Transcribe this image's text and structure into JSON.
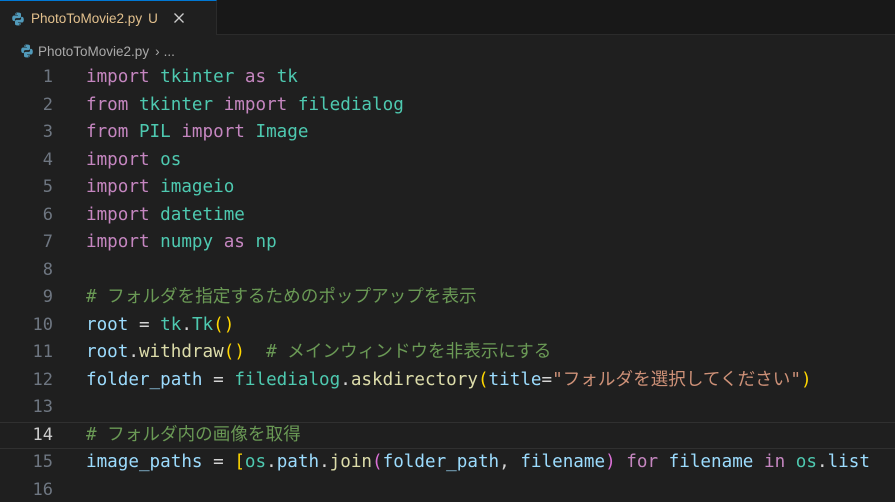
{
  "tab": {
    "filename": "PhotoToMovie2.py",
    "status": "U",
    "icon": "python-icon",
    "close_icon": "close-icon"
  },
  "breadcrumb": {
    "file": "PhotoToMovie2.py",
    "separator": "›",
    "more": "..."
  },
  "editor": {
    "current_line": 14,
    "lines": [
      {
        "n": "1",
        "text": "import tkinter as tk"
      },
      {
        "n": "2",
        "text": "from tkinter import filedialog"
      },
      {
        "n": "3",
        "text": "from PIL import Image"
      },
      {
        "n": "4",
        "text": "import os"
      },
      {
        "n": "5",
        "text": "import imageio"
      },
      {
        "n": "6",
        "text": "import datetime"
      },
      {
        "n": "7",
        "text": "import numpy as np"
      },
      {
        "n": "8",
        "text": ""
      },
      {
        "n": "9",
        "text": "# フォルダを指定するためのポップアップを表示"
      },
      {
        "n": "10",
        "text": "root = tk.Tk()"
      },
      {
        "n": "11",
        "text": "root.withdraw()  # メインウィンドウを非表示にする"
      },
      {
        "n": "12",
        "text": "folder_path = filedialog.askdirectory(title=\"フォルダを選択してください\")"
      },
      {
        "n": "13",
        "text": ""
      },
      {
        "n": "14",
        "text": "# フォルダ内の画像を取得"
      },
      {
        "n": "15",
        "text": "image_paths = [os.path.join(folder_path, filename) for filename in os.list"
      },
      {
        "n": "16",
        "text": ""
      }
    ]
  }
}
